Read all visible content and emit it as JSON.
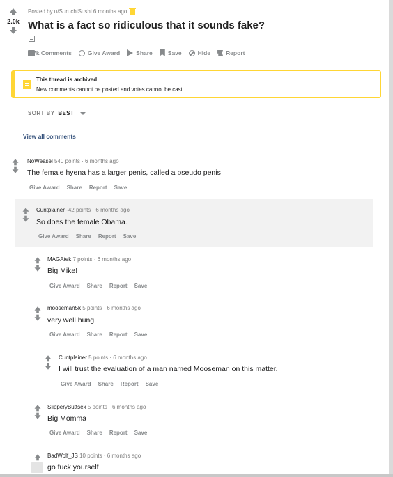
{
  "post": {
    "meta": "Posted by u/SuruchiSushi 6 months ago",
    "vote_count": "2.0k",
    "title": "What is a fact so ridiculous that it sounds fake?",
    "actions": {
      "comments": "2.7k Comments",
      "award": "Give Award",
      "share": "Share",
      "save": "Save",
      "hide": "Hide",
      "report": "Report"
    }
  },
  "archived": {
    "title": "This thread is archived",
    "subtitle": "New comments cannot be posted and votes cannot be cast"
  },
  "sort": {
    "label": "SORT BY",
    "value": "BEST"
  },
  "view_all": "View all comments",
  "comment_actions": {
    "award": "Give Award",
    "share": "Share",
    "report": "Report",
    "save": "Save"
  },
  "comments": [
    {
      "author": "NoWeasel",
      "points": "540 points",
      "time": "· 6 months ago",
      "body": "The female hyena has a larger penis, called a pseudo penis"
    },
    {
      "author": "Cuntplainer",
      "points": "-42 points",
      "time": "· 6 months ago",
      "body": "So does the female Obama."
    },
    {
      "author": "MAGAtek",
      "points": "7 points",
      "time": "· 6 months ago",
      "body": "Big Mike!"
    },
    {
      "author": "mooseman5k",
      "points": "5 points",
      "time": "· 6 months ago",
      "body": "very well hung"
    },
    {
      "author": "Cuntplainer",
      "points": "5 points",
      "time": "· 6 months ago",
      "body": "I will trust the evaluation of a man named Mooseman on this matter."
    },
    {
      "author": "SlipperyButtsex",
      "points": "5 points",
      "time": "· 6 months ago",
      "body": "Big Momma"
    },
    {
      "author": "BadWolf_JS",
      "points": "10 points",
      "time": "· 6 months ago",
      "body": "go fuck yourself"
    }
  ],
  "colors": {
    "accent_yellow": "#ffd635",
    "link_blue": "#33507a",
    "muted": "#878a8c"
  }
}
